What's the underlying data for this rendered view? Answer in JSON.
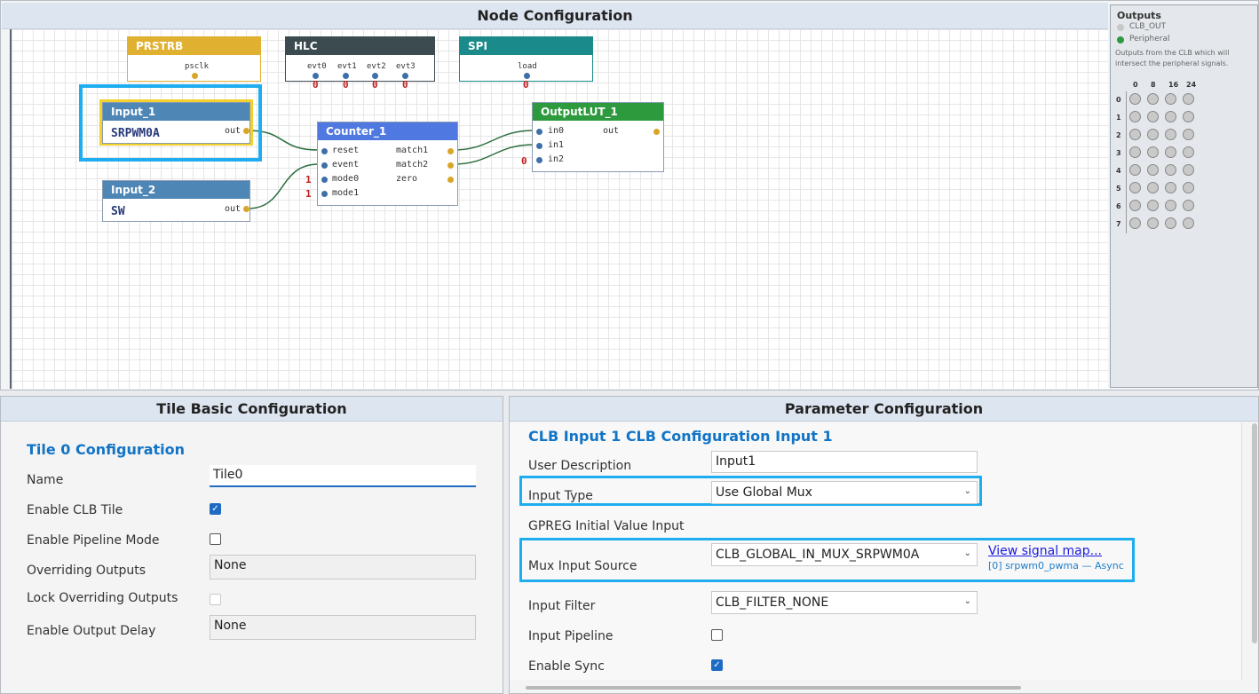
{
  "node_config": {
    "title": "Node Configuration",
    "nodes": {
      "prstrb": {
        "title": "PRSTRB",
        "port": "psclk"
      },
      "hlc": {
        "title": "HLC",
        "ports": [
          "evt0",
          "evt1",
          "evt2",
          "evt3"
        ],
        "values": [
          "0",
          "0",
          "0",
          "0"
        ]
      },
      "spi": {
        "title": "SPI",
        "port": "load",
        "value": "0"
      },
      "input1": {
        "title": "Input_1",
        "signal": "SRPWM0A",
        "out": "out"
      },
      "input2": {
        "title": "Input_2",
        "signal": "SW",
        "out": "out"
      },
      "counter": {
        "title": "Counter_1",
        "inputs": [
          "reset",
          "event",
          "mode0",
          "mode1"
        ],
        "outputs": [
          "match1",
          "match2",
          "zero"
        ],
        "mode0_value": "1",
        "mode1_value": "1"
      },
      "outputlut": {
        "title": "OutputLUT_1",
        "inputs": [
          "in0",
          "in1",
          "in2"
        ],
        "out": "out",
        "in2_value": "0"
      }
    },
    "colors": {
      "prstrb": "#e0b030",
      "hlc": "#3c4b4f",
      "spi": "#1a8a8a",
      "input": "#4e86b6",
      "counter": "#4f78e0",
      "outputlut": "#2e9a3e",
      "highlight": "#1eaef0"
    }
  },
  "outputs_panel": {
    "title": "Outputs",
    "legend": [
      {
        "label": "CLB_OUT",
        "color": "#c8c8c8"
      },
      {
        "label": "Peripheral",
        "color": "#2e9a3e"
      }
    ],
    "description": "Outputs from the CLB which will intersect the peripheral signals.",
    "col_headers": [
      "0",
      "8",
      "16",
      "24"
    ],
    "row_headers": [
      "0",
      "1",
      "2",
      "3",
      "4",
      "5",
      "6",
      "7"
    ]
  },
  "tile_config": {
    "title": "Tile Basic Configuration",
    "section": "Tile 0 Configuration",
    "name_label": "Name",
    "name_value": "Tile0",
    "enable_clb_label": "Enable CLB Tile",
    "enable_clb": true,
    "pipeline_label": "Enable Pipeline Mode",
    "pipeline": false,
    "overriding_label": "Overriding Outputs",
    "overriding_value": "None",
    "lock_label": "Lock Overriding Outputs",
    "lock": false,
    "delay_label": "Enable Output Delay",
    "delay_value": "None"
  },
  "param_config": {
    "title": "Parameter Configuration",
    "section": "CLB Input 1 CLB Configuration Input 1",
    "user_desc_label": "User Description",
    "user_desc_value": "Input1",
    "input_type_label": "Input Type",
    "input_type_value": "Use Global Mux",
    "gpreg_label": "GPREG Initial Value Input",
    "mux_label": "Mux Input Source",
    "mux_value": "CLB_GLOBAL_IN_MUX_SRPWM0A",
    "signal_map_link": "View signal map...",
    "signal_map_info": "[0] srpwm0_pwma — Async",
    "filter_label": "Input Filter",
    "filter_value": "CLB_FILTER_NONE",
    "pipeline_label": "Input Pipeline",
    "pipeline": false,
    "sync_label": "Enable Sync",
    "sync": true
  }
}
